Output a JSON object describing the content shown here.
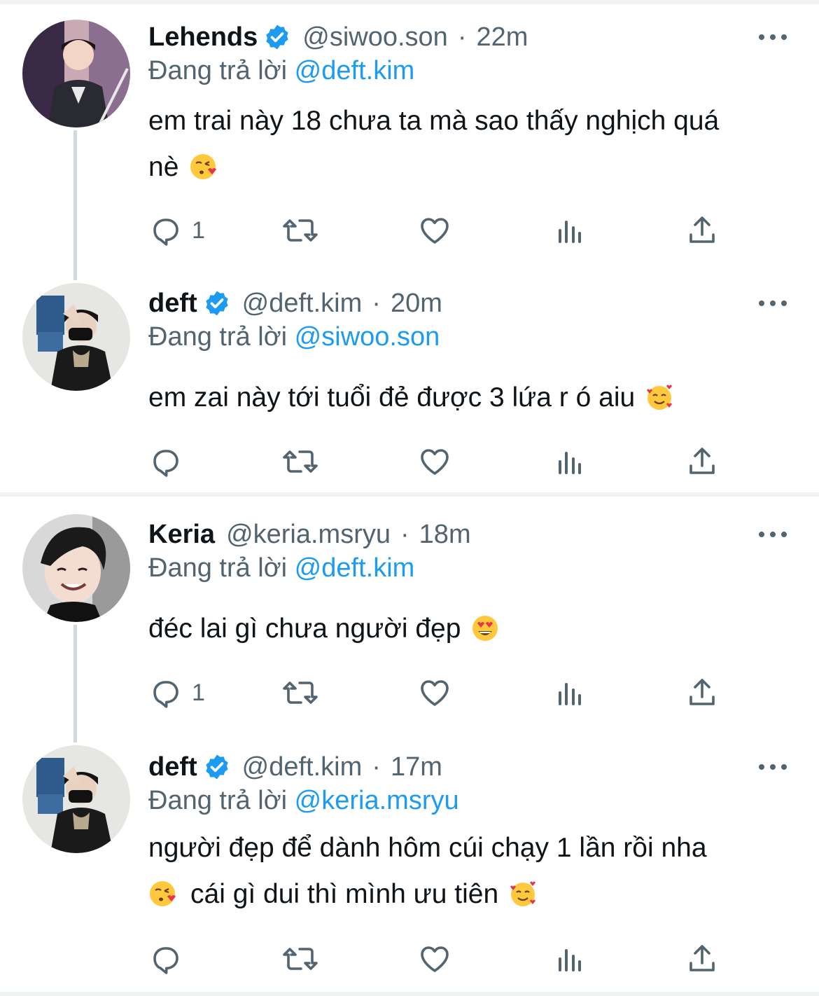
{
  "tweets": [
    {
      "name": "Lehends",
      "verified": true,
      "handle": "@siwoo.son",
      "separator": "·",
      "time": "22m",
      "replying_prefix": "Đang trả lời ",
      "replying_to": "@deft.kim",
      "text_line1": "em trai này 18 chưa ta mà sao thấy nghịch quá",
      "text_line2": "nè",
      "emoji_1": "face-blowing-kiss",
      "reply_count": "1"
    },
    {
      "name": "deft",
      "verified": true,
      "handle": "@deft.kim",
      "separator": "·",
      "time": "20m",
      "replying_prefix": "Đang trả lời ",
      "replying_to": "@siwoo.son",
      "text_line1": "em zai này tới tuổi đẻ được 3 lứa r ó aiu",
      "emoji_1": "smiling-face-with-hearts",
      "reply_count": ""
    },
    {
      "name": "Keria",
      "verified": false,
      "handle": "@keria.msryu",
      "separator": "·",
      "time": "18m",
      "replying_prefix": "Đang trả lời ",
      "replying_to": "@deft.kim",
      "text_line1": "đéc lai gì chưa người đẹp",
      "emoji_1": "smiling-face-with-heart-eyes",
      "reply_count": "1"
    },
    {
      "name": "deft",
      "verified": true,
      "handle": "@deft.kim",
      "separator": "·",
      "time": "17m",
      "replying_prefix": "Đang trả lời ",
      "replying_to": "@keria.msryu",
      "text_line1": "người đẹp để dành hôm cúi chạy 1 lần rồi nha",
      "text_line2": "cái gì dui thì mình ưu tiên",
      "emoji_1": "face-blowing-kiss",
      "emoji_2": "smiling-face-with-hearts",
      "reply_count": ""
    }
  ],
  "colors": {
    "text": "#0f1419",
    "secondary": "#536471",
    "accent": "#1d9bf0",
    "separator": "#eff3f4",
    "thread_line": "#cfd9de"
  },
  "icons": [
    "reply-icon",
    "retweet-icon",
    "like-icon",
    "analytics-icon",
    "share-icon",
    "more-icon",
    "verified-badge-icon"
  ]
}
